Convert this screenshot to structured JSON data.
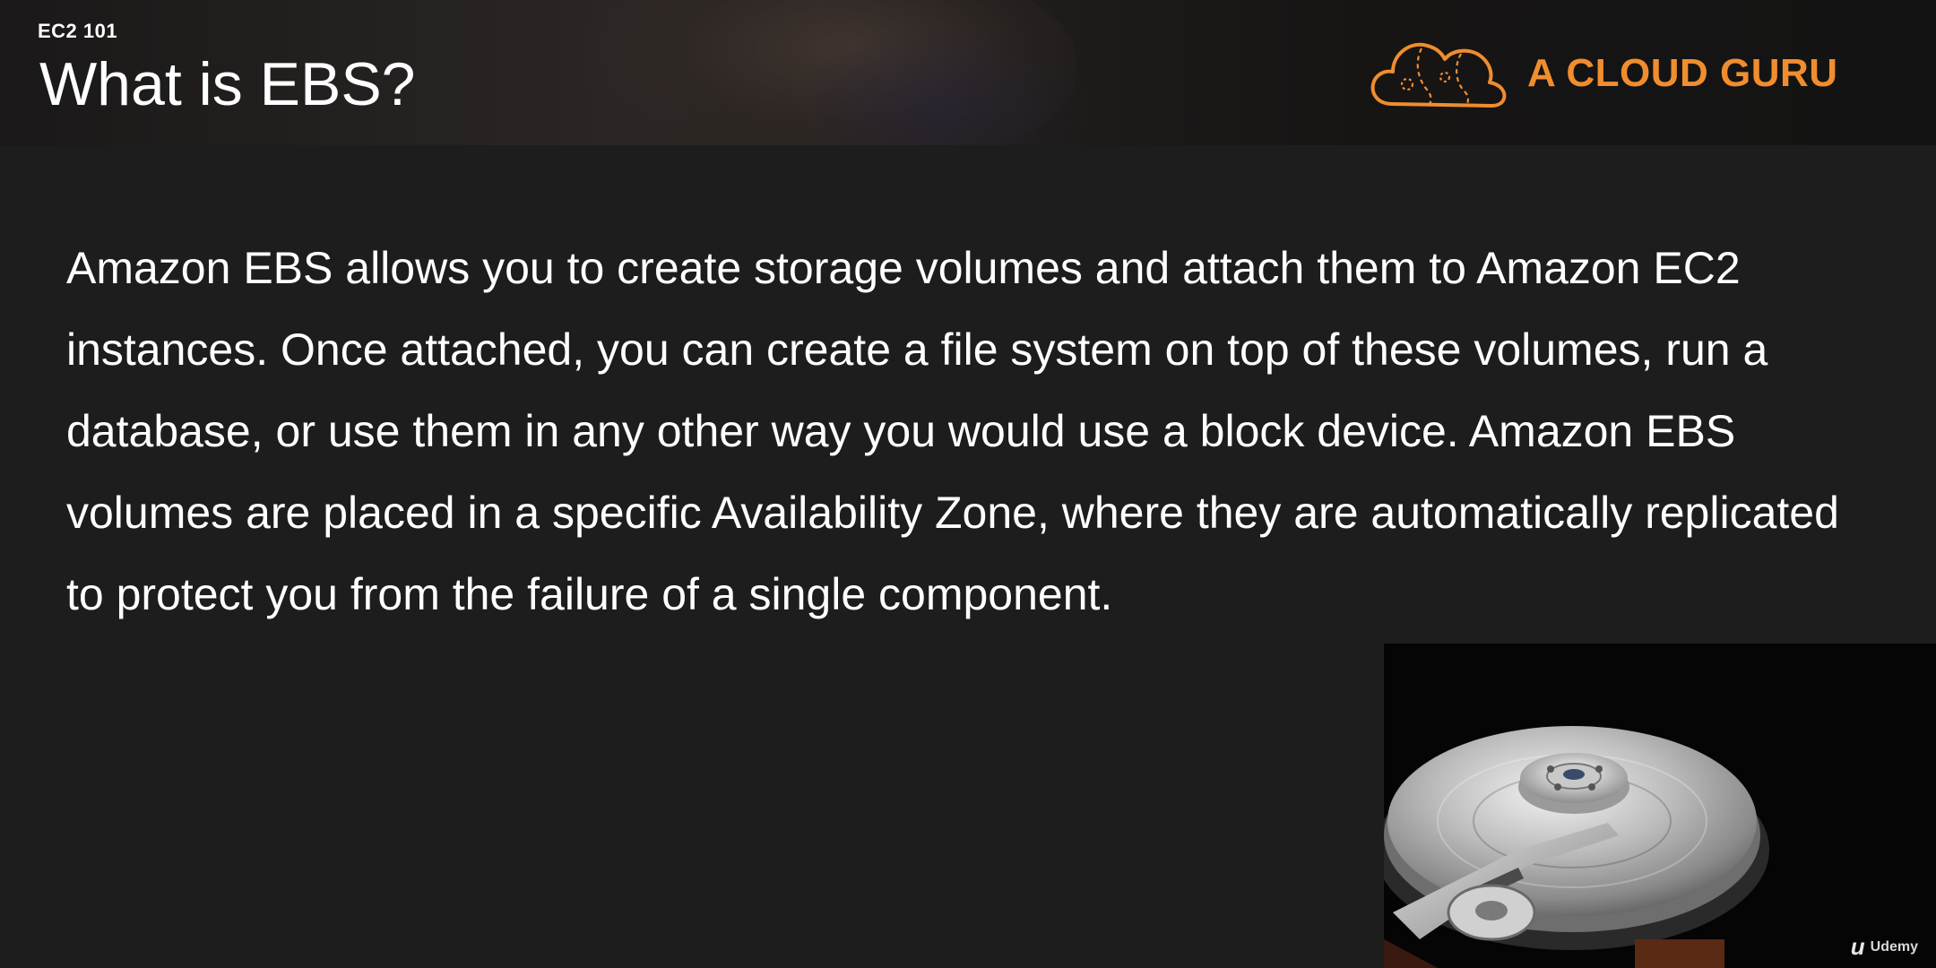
{
  "header": {
    "section_label": "EC2 101",
    "title": "What is EBS?",
    "brand_name": "A CLOUD GURU",
    "brand_color": "#f08d2e"
  },
  "content": {
    "paragraph": "Amazon EBS allows you to create storage volumes and attach them to Amazon EC2 instances. Once attached, you can create a file system on top of these volumes, run a database, or use them in any other way you would use a block device. Amazon EBS volumes are placed in a specific Availability Zone, where they are automatically replicated to protect you from the failure of a single component."
  },
  "image": {
    "subject": "hard-disk-drive-photo"
  },
  "watermark": {
    "label": "Udemy"
  }
}
